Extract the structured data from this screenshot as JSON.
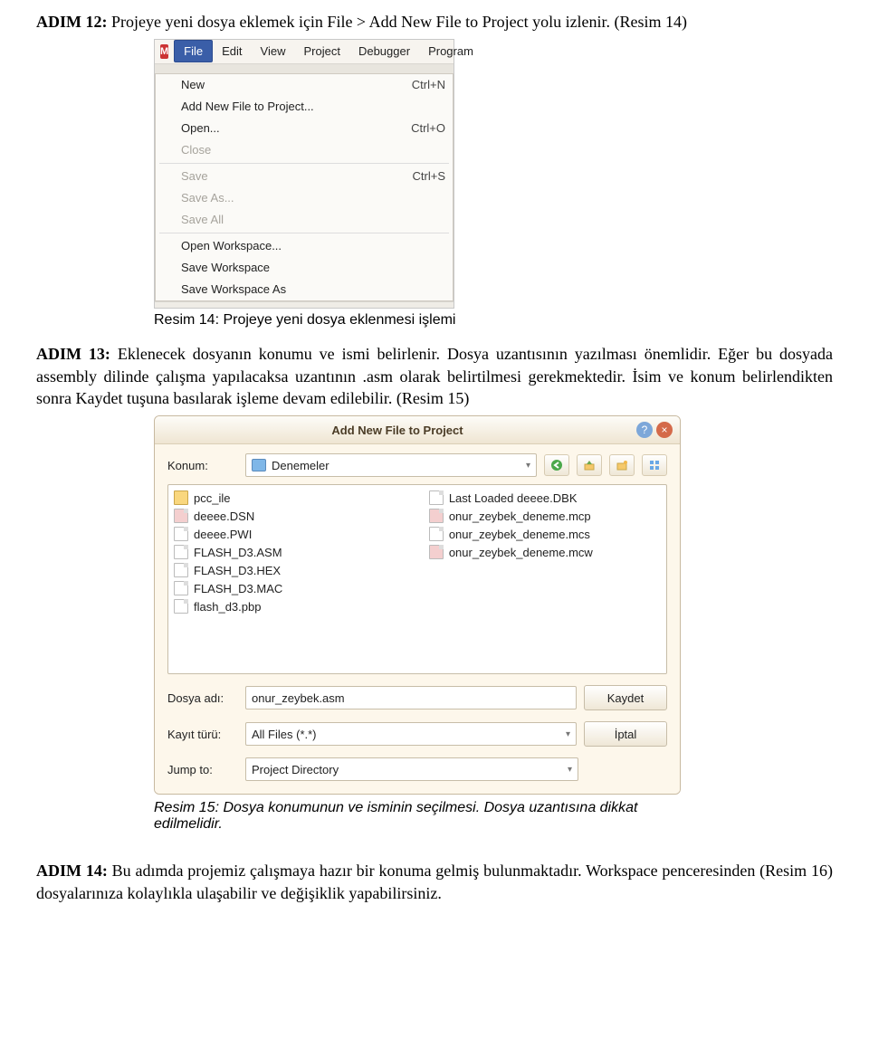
{
  "para1_bold": "ADIM 12:",
  "para1_rest": " Projeye yeni dosya eklemek için File > Add New File to Project yolu izlenir. (Resim 14)",
  "fig1": {
    "app_icon": "M",
    "menu": {
      "file": "File",
      "edit": "Edit",
      "view": "View",
      "project": "Project",
      "debugger": "Debugger",
      "program": "Program"
    },
    "items": {
      "new": "New",
      "new_sc": "Ctrl+N",
      "add": "Add New File to Project...",
      "open": "Open...",
      "open_sc": "Ctrl+O",
      "close": "Close",
      "save": "Save",
      "save_sc": "Ctrl+S",
      "saveas": "Save As...",
      "saveall": "Save All",
      "openws": "Open Workspace...",
      "savews": "Save Workspace",
      "savewsas": "Save Workspace As"
    }
  },
  "caption1": "Resim 14: Projeye yeni dosya eklenmesi işlemi",
  "para2_bold": "ADIM 13:",
  "para2_rest": " Eklenecek dosyanın konumu ve ismi belirlenir. Dosya uzantısının yazılması önemlidir. Eğer bu dosyada assembly dilinde çalışma yapılacaksa uzantının .asm olarak belirtilmesi gerekmektedir. İsim ve konum belirlendikten sonra Kaydet tuşuna basılarak işleme devam edilebilir. (Resim 15)",
  "fig2": {
    "title": "Add New File to Project",
    "konum_label": "Konum:",
    "konum_value": "Denemeler",
    "left": [
      {
        "t": "pcc_ile",
        "k": "folder"
      },
      {
        "t": "deeee.DSN",
        "k": "red"
      },
      {
        "t": "deeee.PWI",
        "k": "file"
      },
      {
        "t": "FLASH_D3.ASM",
        "k": "file"
      },
      {
        "t": "FLASH_D3.HEX",
        "k": "file"
      },
      {
        "t": "FLASH_D3.MAC",
        "k": "file"
      },
      {
        "t": "flash_d3.pbp",
        "k": "file"
      }
    ],
    "right": [
      {
        "t": "Last Loaded deeee.DBK",
        "k": "file"
      },
      {
        "t": "onur_zeybek_deneme.mcp",
        "k": "red"
      },
      {
        "t": "onur_zeybek_deneme.mcs",
        "k": "file"
      },
      {
        "t": "onur_zeybek_deneme.mcw",
        "k": "red"
      }
    ],
    "dosya_adi_label": "Dosya adı:",
    "dosya_adi_value": "onur_zeybek.asm",
    "kayit_turu_label": "Kayıt türü:",
    "kayit_turu_value": "All Files (*.*)",
    "jump_label": "Jump to:",
    "jump_value": "Project Directory",
    "kaydet": "Kaydet",
    "iptal": "İptal"
  },
  "caption2": "Resim 15: Dosya konumunun ve isminin seçilmesi. Dosya uzantısına dikkat edilmelidir.",
  "para3_bold": "ADIM 14:",
  "para3_rest": " Bu adımda projemiz çalışmaya hazır bir konuma gelmiş bulunmaktadır. Workspace penceresinden (Resim 16) dosyalarınıza kolaylıkla ulaşabilir ve değişiklik yapabilirsiniz."
}
